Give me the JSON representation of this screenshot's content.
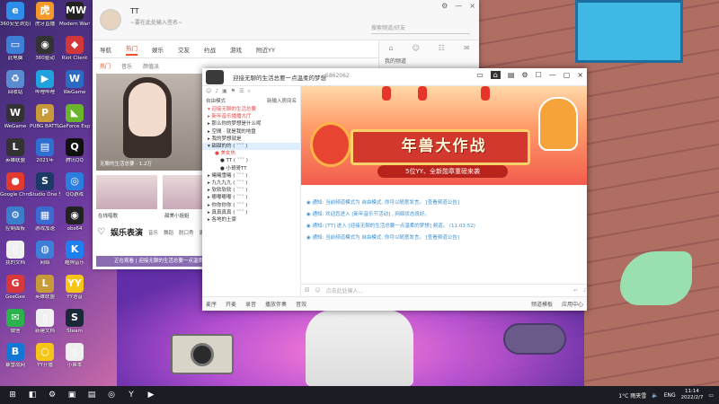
{
  "desktop": {
    "icons": [
      {
        "label": "360安全浏览器",
        "glyph": "e",
        "color": "#2d8de8"
      },
      {
        "label": "虎牙直播",
        "glyph": "虎",
        "color": "#f39a2a"
      },
      {
        "label": "Modern Warfare",
        "glyph": "MW",
        "color": "#222"
      },
      {
        "label": "此电脑",
        "glyph": "▭",
        "color": "#3d7fd6"
      },
      {
        "label": "360驱动",
        "glyph": "◉",
        "color": "#333"
      },
      {
        "label": "Riot Client",
        "glyph": "◆",
        "color": "#d13639"
      },
      {
        "label": "回收站",
        "glyph": "♻",
        "color": "#5a8bd0"
      },
      {
        "label": "哔哩哔哩",
        "glyph": "▶",
        "color": "#1fa2dd"
      },
      {
        "label": "WeGame",
        "glyph": "W",
        "color": "#2c6bc4"
      },
      {
        "label": "WeGame",
        "glyph": "W",
        "color": "#333"
      },
      {
        "label": "PUBG BATTLEGR.",
        "glyph": "P",
        "color": "#c99a3a"
      },
      {
        "label": "GeForce Experience",
        "glyph": "◣",
        "color": "#6bb52c"
      },
      {
        "label": "英雄联盟",
        "glyph": "L",
        "color": "#333"
      },
      {
        "label": "2021年",
        "glyph": "▤",
        "color": "#2f6fd0"
      },
      {
        "label": "腾讯QQ",
        "glyph": "Q",
        "color": "#111"
      },
      {
        "label": "Google Chrome",
        "glyph": "●",
        "color": "#e23b2e"
      },
      {
        "label": "Studio One 5",
        "glyph": "S",
        "color": "#1b3a66"
      },
      {
        "label": "QQ游戏",
        "glyph": "◎",
        "color": "#2b7de0"
      },
      {
        "label": "控制面板",
        "glyph": "⚙",
        "color": "#3b7dc8"
      },
      {
        "label": "游戏加速",
        "glyph": "▦",
        "color": "#3a6bd0"
      },
      {
        "label": "obs64",
        "glyph": "◉",
        "color": "#222"
      },
      {
        "label": "我的文档",
        "glyph": "▯",
        "color": "#f0f0f0"
      },
      {
        "label": "网络",
        "glyph": "◍",
        "color": "#3d7fd6"
      },
      {
        "label": "酷狗音乐",
        "glyph": "K",
        "color": "#1d7ff0"
      },
      {
        "label": "GeeGee",
        "glyph": "G",
        "color": "#d9383a"
      },
      {
        "label": "英雄联盟",
        "glyph": "L",
        "color": "#c79a3a"
      },
      {
        "label": "YY语音",
        "glyph": "YY",
        "color": "#f5c518"
      },
      {
        "label": "微信",
        "glyph": "✉",
        "color": "#2bb24c"
      },
      {
        "label": "新建文档",
        "glyph": "▯",
        "color": "#f0f0f0"
      },
      {
        "label": "Steam",
        "glyph": "S",
        "color": "#1b2838"
      },
      {
        "label": "暴雪战网",
        "glyph": "B",
        "color": "#1477d6"
      },
      {
        "label": "YY开播",
        "glyph": "○",
        "color": "#f5c518"
      },
      {
        "label": "小票本",
        "glyph": "▯",
        "color": "#f0f0f0"
      }
    ]
  },
  "yy_main": {
    "user_name": "TT",
    "signature": "~要在此处输入签名~",
    "search_placeholder": "搜索频道/好友",
    "window_buttons": [
      "⚙",
      "—",
      "×"
    ],
    "tabs": [
      "导航",
      "热门",
      "娱乐",
      "交友",
      "约战",
      "游戏",
      "附近YY"
    ],
    "active_tab": "热门",
    "subtabs": [
      "热门",
      "音乐",
      "颜值派"
    ],
    "stream_caption": "无聊的生活总要",
    "stream_viewers": "1.2万",
    "thumbs": [
      "在线唱歌",
      "甜美小姐姐"
    ],
    "section_title": "娱乐表演",
    "section_links": [
      "音乐",
      "舞蹈",
      "脱口秀",
      "更多"
    ],
    "notice": "正在观看 | 迎接无聊的生活总要一点温柔的梦想",
    "right_items": [
      "我的频道"
    ]
  },
  "room": {
    "title": "迎接无聊的生活总要一点温柔的梦想",
    "room_id": "5862062",
    "tools": [
      "▭",
      "⌂",
      "▤",
      "⚙",
      "☐",
      "—",
      "▢",
      "×"
    ],
    "sidebar_toolbar": [
      "☺",
      "♪",
      "▣",
      "⚑",
      "☰",
      "⌕"
    ],
    "sidebar_mode": "自由模式",
    "sidebar_search": "新输入房间名",
    "channels": [
      {
        "label": "▾ 迎接无聊的生活总要",
        "cls": "red"
      },
      {
        "label": "▸ 新年音乐播播大厅",
        "cls": "red"
      },
      {
        "label": "▸ 那么你的梦想是什么呢",
        "cls": ""
      },
      {
        "label": "▸ 空間 · 就是我的地盘",
        "cls": ""
      },
      {
        "label": "▸ 我的梦想就是",
        "cls": ""
      },
      {
        "label": "▾ 甜甜的的 ( ˘˘˘ )",
        "cls": "sel"
      },
      {
        "label": "● 美女热",
        "cls": "sub red"
      },
      {
        "label": "● TT ( ˘˘˘ )",
        "cls": "sub2"
      },
      {
        "label": "● 小哥哥TT",
        "cls": "sub2"
      },
      {
        "label": "▸ 曦曦雪曦 ( ˘˘˘ )",
        "cls": ""
      },
      {
        "label": "▸ 九九九九 ( ˘˘˘ )",
        "cls": ""
      },
      {
        "label": "▸ 软软软软 ( ˘˘˘ )",
        "cls": ""
      },
      {
        "label": "▸ 嘟嘟嘟嘟 ( ˘˘˘ )",
        "cls": ""
      },
      {
        "label": "▸ 你你你你 ( ˘˘˘ )",
        "cls": ""
      },
      {
        "label": "▸ 真真真真 ( ˘˘˘ )",
        "cls": ""
      },
      {
        "label": "▸ 各地的土豪",
        "cls": ""
      }
    ],
    "banner_title": "年兽大作战",
    "banner_sub": "5位YY、全新勋章重磅来袭",
    "messages": [
      "◉ 通知: 当前频道模式为 自由模式, 你可以随意发言。 [查看频道公告]",
      "◉ 通知: 欢迎您进入 [新年音乐节活动] , 网络状态良好。",
      "◉ 通知: [TT] 进入 [迎接无聊的生活总要一点温柔的梦想] 频道。 (11:03:52)",
      "◉ 通知: 当前频道模式为 自由模式, 你可以随意发言。 [查看频道公告]"
    ],
    "input_placeholder": "点击此处输入...",
    "bottom_left": [
      "麦序",
      "开麦",
      "录音",
      "播放伴奏",
      "音效"
    ],
    "bottom_right": [
      "频道模板",
      "应用中心"
    ]
  },
  "taskbar": {
    "weather": "1°C 雨夹雪",
    "lang": "ENG",
    "time": "11:14",
    "date": "2022/2/7"
  }
}
